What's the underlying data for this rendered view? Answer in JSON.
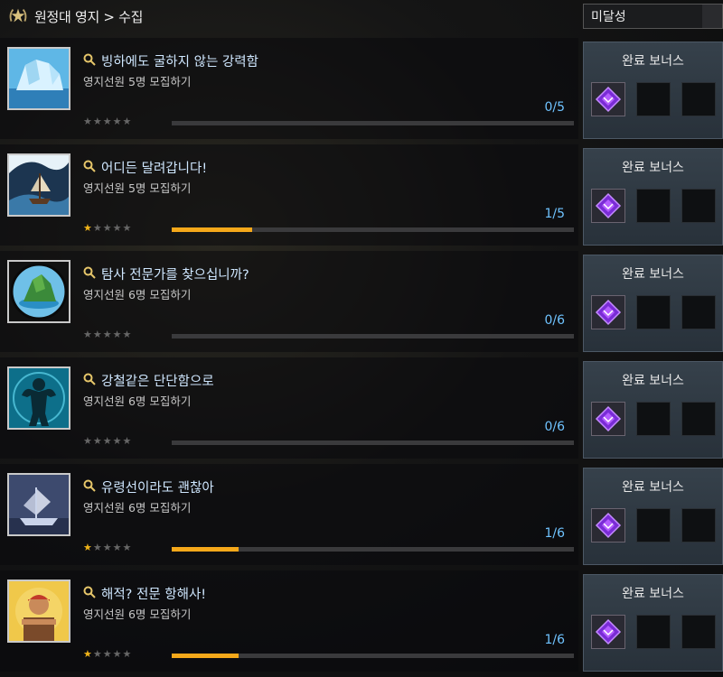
{
  "header": {
    "breadcrumb": "원정대 영지 > 수집",
    "crest_icon": "laurel-crest-icon"
  },
  "filter": {
    "selected": "미달성"
  },
  "missions": [
    {
      "title": "빙하에도 굴하지 않는 강력함",
      "subtitle": "영지선원 5명 모집하기",
      "count": "0/5",
      "stars": 0,
      "progress": 0.0,
      "thumb": "iceberg",
      "bonus_label": "완료 보너스"
    },
    {
      "title": "어디든 달려갑니다!",
      "subtitle": "영지선원 5명 모집하기",
      "count": "1/5",
      "stars": 1,
      "progress": 0.2,
      "thumb": "ship-wave",
      "bonus_label": "완료 보너스"
    },
    {
      "title": "탐사 전문가를 찾으십니까?",
      "subtitle": "영지선원 6명 모집하기",
      "count": "0/6",
      "stars": 0,
      "progress": 0.0,
      "thumb": "island",
      "bonus_label": "완료 보너스"
    },
    {
      "title": "강철같은 단단함으로",
      "subtitle": "영지선원 6명 모집하기",
      "count": "0/6",
      "stars": 0,
      "progress": 0.0,
      "thumb": "strong-figure",
      "bonus_label": "완료 보너스"
    },
    {
      "title": "유령선이라도 괜찮아",
      "subtitle": "영지선원 6명 모집하기",
      "count": "1/6",
      "stars": 1,
      "progress": 0.167,
      "thumb": "ghost-ship",
      "bonus_label": "완료 보너스"
    },
    {
      "title": "해적? 전문 항해사!",
      "subtitle": "영지선원 6명 모집하기",
      "count": "1/6",
      "stars": 1,
      "progress": 0.167,
      "thumb": "pirate",
      "bonus_label": "완료 보너스"
    }
  ],
  "colors": {
    "progress_fill": "#f5a81a",
    "count_text": "#6fc3ff",
    "star_on": "#f0b419",
    "bonus_item": "#9b3cff"
  }
}
